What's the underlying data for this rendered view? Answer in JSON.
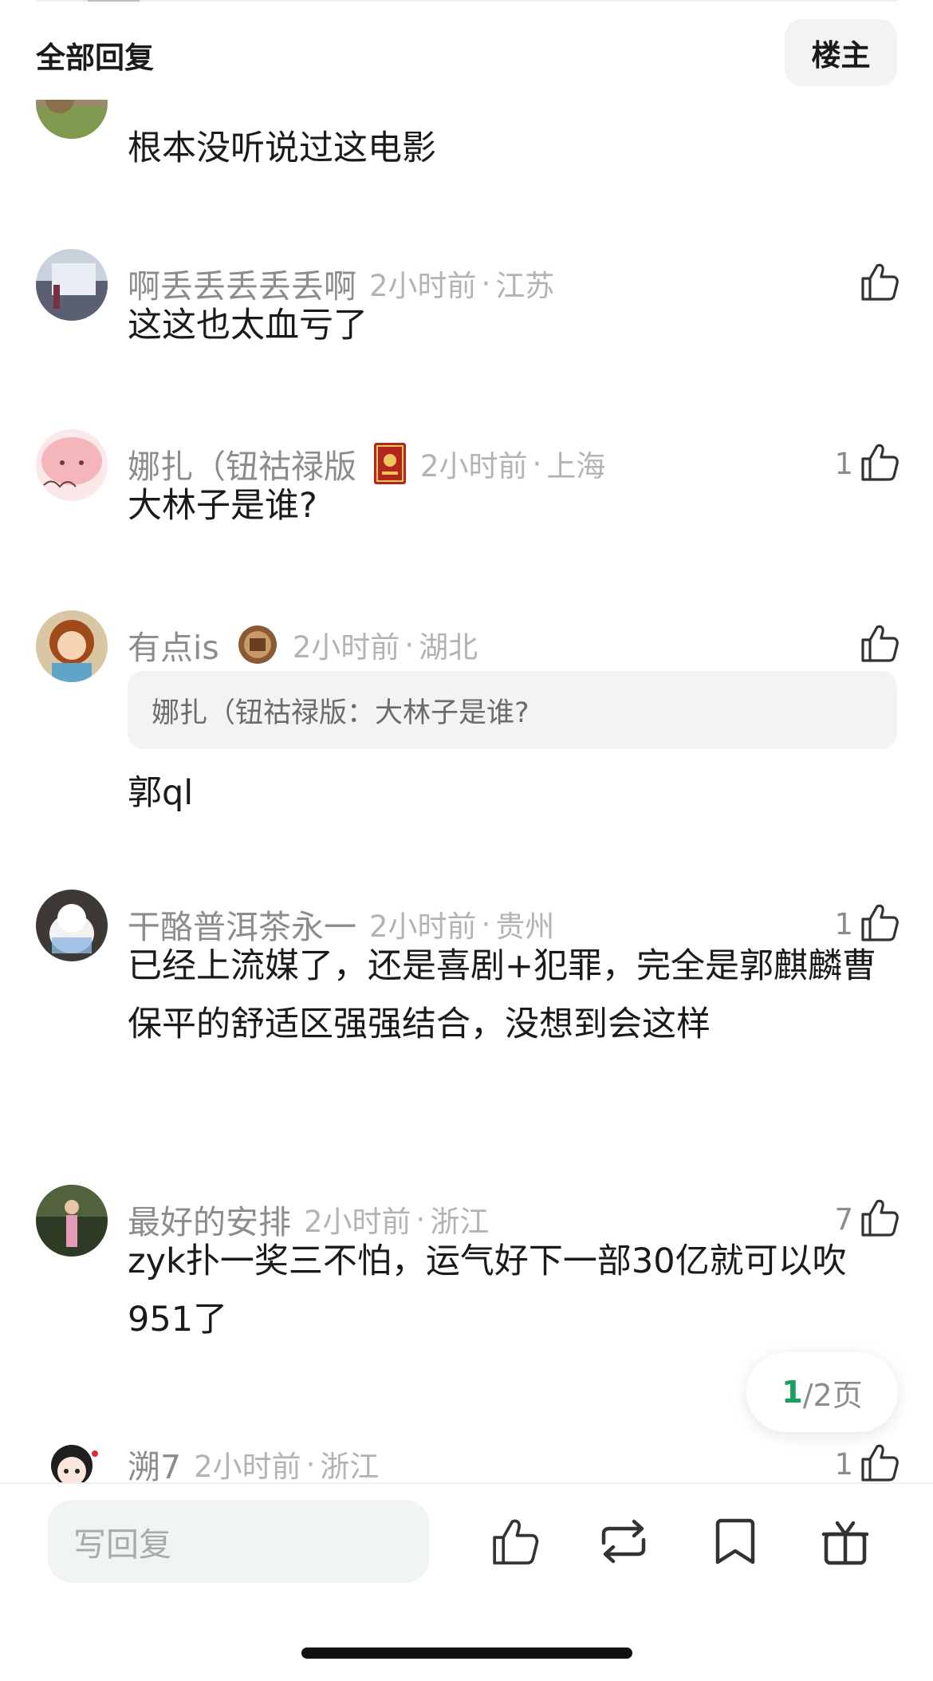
{
  "header": {
    "title": "全部回复",
    "op_button": "楼主"
  },
  "comments": [
    {
      "username": "",
      "time": "",
      "location": "",
      "likes": "",
      "text": "根本没听说过这电影"
    },
    {
      "username": "啊丢丢丢丢丢啊",
      "time": "2小时前",
      "location": "江苏",
      "likes": "",
      "text": "这这也太血亏了"
    },
    {
      "username": "娜扎（钮祜禄版",
      "time": "2小时前",
      "location": "上海",
      "likes": "1",
      "text": "大林子是谁?"
    },
    {
      "username": "有点is",
      "time": "2小时前",
      "location": "湖北",
      "likes": "",
      "quote": "娜扎（钮祜禄版：大林子是谁?",
      "text": "郭ql"
    },
    {
      "username": "干酪普洱茶永一",
      "time": "2小时前",
      "location": "贵州",
      "likes": "1",
      "text": "已经上流媒了，还是喜剧+犯罪，完全是郭麒麟曹保平的舒适区强强结合，没想到会这样"
    },
    {
      "username": "最好的安排",
      "time": "2小时前",
      "location": "浙江",
      "likes": "7",
      "text": "zyk扑一奖三不怕，运气好下一部30亿就可以吹951了"
    },
    {
      "username": "溯7",
      "time": "2小时前",
      "location": "浙江",
      "likes": "1",
      "text": ""
    }
  ],
  "pager": {
    "current": "1",
    "total": "/2页"
  },
  "bottom_bar": {
    "reply_placeholder": "写回复"
  },
  "icons": [
    "thumbs-up-icon",
    "repost-icon",
    "bookmark-icon",
    "gift-icon"
  ],
  "colors": {
    "accent_green": "#19a15f",
    "meta_gray": "#b3b3b3",
    "name_gray": "#8c8c8c"
  }
}
